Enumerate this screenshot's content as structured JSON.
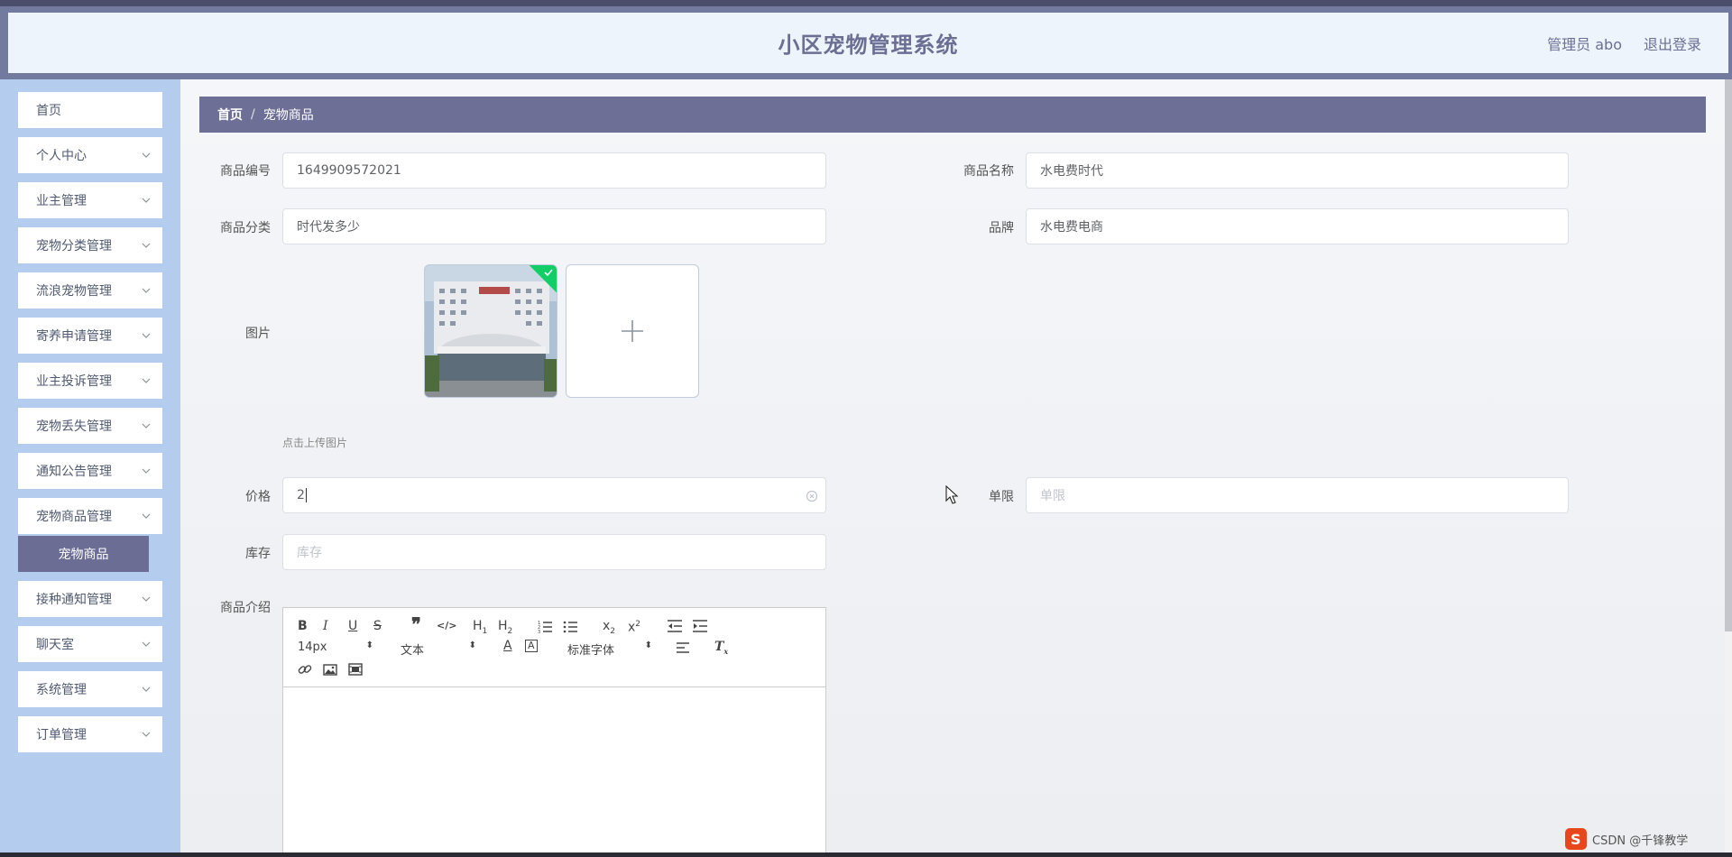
{
  "app": {
    "title": "小区宠物管理系统",
    "user_label": "管理员 abo",
    "logout_label": "退出登录"
  },
  "sidebar": {
    "items": [
      {
        "label": "首页",
        "has_arrow": false
      },
      {
        "label": "个人中心",
        "has_arrow": true
      },
      {
        "label": "业主管理",
        "has_arrow": true
      },
      {
        "label": "宠物分类管理",
        "has_arrow": true
      },
      {
        "label": "流浪宠物管理",
        "has_arrow": true
      },
      {
        "label": "寄养申请管理",
        "has_arrow": true
      },
      {
        "label": "业主投诉管理",
        "has_arrow": true
      },
      {
        "label": "宠物丢失管理",
        "has_arrow": true
      },
      {
        "label": "通知公告管理",
        "has_arrow": true
      },
      {
        "label": "宠物商品管理",
        "has_arrow": true
      },
      {
        "label": "接种通知管理",
        "has_arrow": true
      },
      {
        "label": "聊天室",
        "has_arrow": true
      },
      {
        "label": "系统管理",
        "has_arrow": true
      },
      {
        "label": "订单管理",
        "has_arrow": true
      }
    ],
    "active_subitem": "宠物商品"
  },
  "breadcrumb": {
    "home": "首页",
    "separator": "/",
    "current": "宠物商品"
  },
  "form": {
    "product_code": {
      "label": "商品编号",
      "value": "1649909572021"
    },
    "product_name": {
      "label": "商品名称",
      "value": "水电费时代"
    },
    "category": {
      "label": "商品分类",
      "value": "时代发多少"
    },
    "brand": {
      "label": "品牌",
      "value": "水电费电商"
    },
    "image": {
      "label": "图片",
      "tip": "点击上传图片"
    },
    "price": {
      "label": "价格",
      "value": "2"
    },
    "limit": {
      "label": "单限",
      "placeholder": "单限"
    },
    "stock": {
      "label": "库存",
      "placeholder": "库存"
    },
    "intro": {
      "label": "商品介绍"
    }
  },
  "editor": {
    "font_size": "14px",
    "block_type": "文本",
    "font_family": "标准字体"
  },
  "watermark": {
    "text": "CSDN @千锋教学"
  },
  "colors": {
    "accent": "#6d6f96",
    "sidebar_bg": "#b4cdee",
    "header_bg": "#eef4fc",
    "upload_success": "#13ce66"
  }
}
